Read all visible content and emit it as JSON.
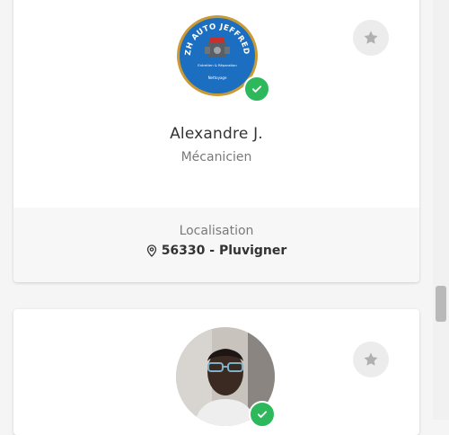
{
  "card1": {
    "name": "Alexandre J.",
    "job": "Mécanicien",
    "location_label": "Localisation",
    "location": "56330 - Pluvigner",
    "logo": {
      "top_text": "BZH AUTO JEFFREDO",
      "line1": "Entretien & Réparation",
      "line2": "Nettoyage"
    },
    "verified": true
  },
  "card2": {
    "verified": true
  },
  "icons": {
    "favorite": "star-icon",
    "verified": "check-icon",
    "location": "map-pin-icon"
  },
  "colors": {
    "verified": "#2eb85c",
    "star": "#b0b0b0",
    "logo_blue": "#1c6fc0",
    "logo_gold": "#c99a35"
  }
}
